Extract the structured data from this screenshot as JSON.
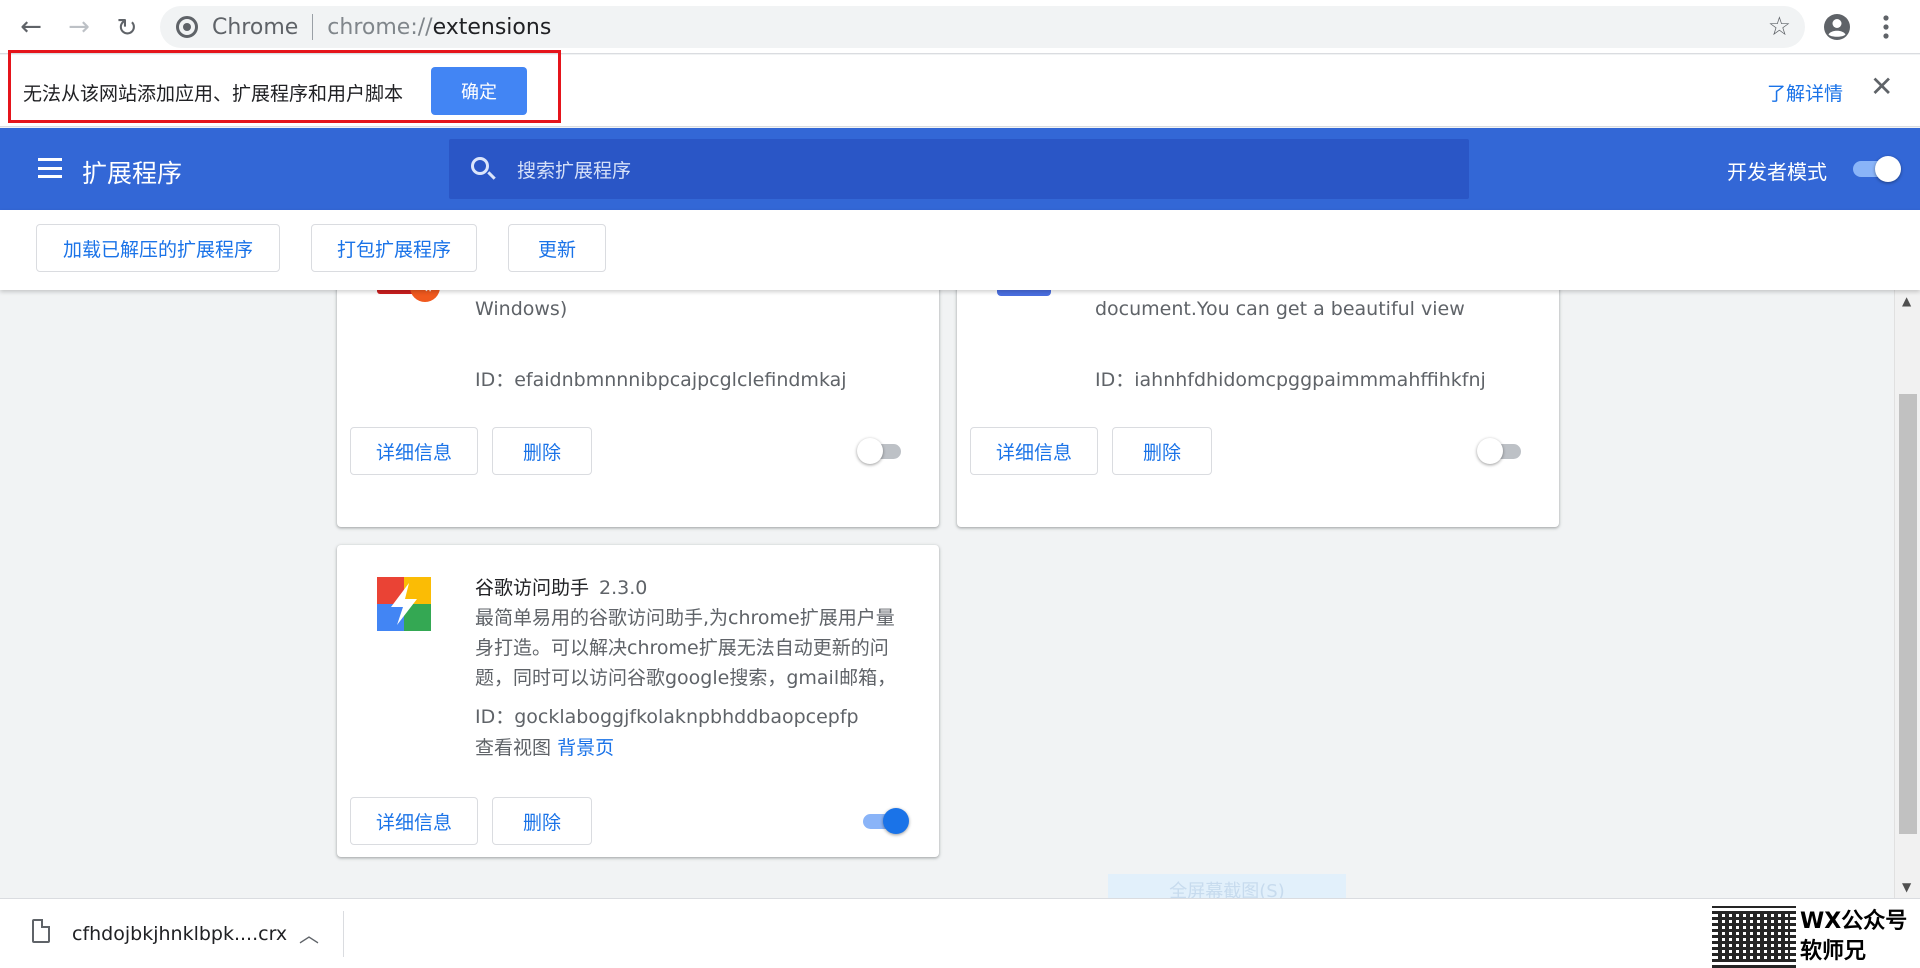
{
  "browser": {
    "site_name": "Chrome",
    "url_scheme": "chrome://",
    "url_host": "extensions",
    "icons": [
      "back-arrow-icon",
      "forward-arrow-icon",
      "reload-icon",
      "star-icon",
      "account-icon",
      "more-vert-icon"
    ]
  },
  "infobar": {
    "message": "无法从该网站添加应用、扩展程序和用户脚本",
    "ok_label": "确定",
    "learn_more": "了解详情",
    "close_symbol": "✕"
  },
  "header": {
    "title": "扩展程序",
    "search_placeholder": "搜索扩展程序",
    "dev_mode_label": "开发者模式",
    "dev_mode_on": true,
    "colors": {
      "header_bg": "#3367d6",
      "accent": "#1a73e8"
    }
  },
  "toolbar": {
    "load_unpacked": "加载已解压的扩展程序",
    "pack": "打包扩展程序",
    "update": "更新"
  },
  "cards": [
    {
      "description": "将当前网页转换为 Adobe PDF 文件（仅限 Windows)",
      "id_text": "ID：efaidnbmnnnibpcajpcglclefindmkaj",
      "details_label": "详细信息",
      "remove_label": "删除",
      "enabled": false
    },
    {
      "description": "It's a browser and editor for JSON document.You can get a beautiful view",
      "id_text": "ID：iahnhfdhidomcpggpaimmmahffihkfnj",
      "details_label": "详细信息",
      "remove_label": "删除",
      "enabled": false
    },
    {
      "name": "谷歌访问助手",
      "version": "2.3.0",
      "description": "最简单易用的谷歌访问助手,为chrome扩展用户量身打造。可以解决chrome扩展无法自动更新的问题，同时可以访问谷歌google搜索，gmail邮箱，",
      "id_text": "ID：gocklaboggjfkolaknpbhddbaopcepfp",
      "views_label": "查看视图",
      "views_link": "背景页",
      "details_label": "详细信息",
      "remove_label": "删除",
      "enabled": true
    }
  ],
  "overlay_button": "全屏幕截图(S)",
  "download": {
    "file_name": "cfhdojbkjhnklbpk....crx"
  },
  "watermark": {
    "line1": "WX公众号",
    "line2": "软师兄"
  }
}
